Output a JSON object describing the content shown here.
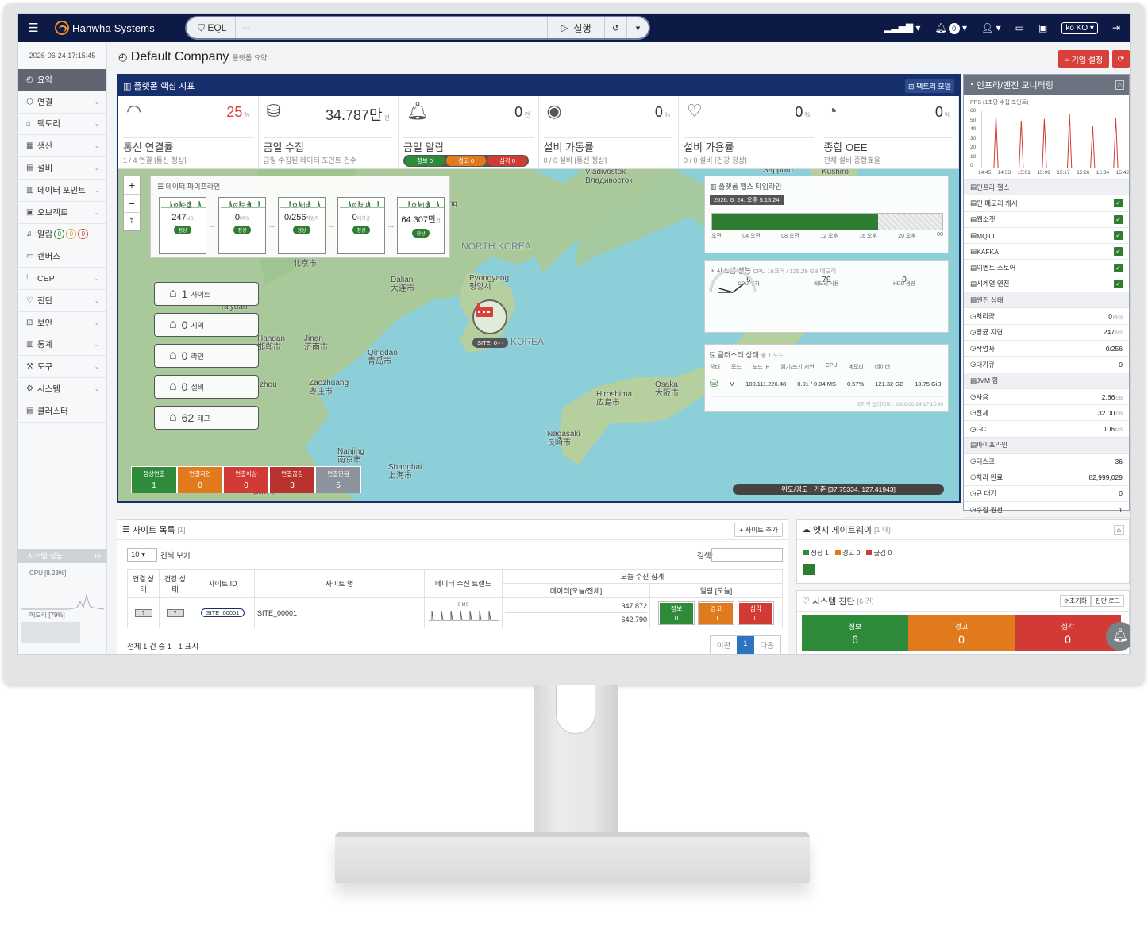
{
  "app": {
    "brand": "Hanwha Systems",
    "eql_label": "EQL",
    "run_label": "실행",
    "lang": "ko KO",
    "notif_count": "0"
  },
  "sidebar": {
    "datetime": "2026-06-24 17:15:45",
    "items": [
      {
        "label": "요약",
        "icon": "◴"
      },
      {
        "label": "연결",
        "icon": "⬡"
      },
      {
        "label": "팩토리",
        "icon": "⌂"
      },
      {
        "label": "생산",
        "icon": "▦"
      },
      {
        "label": "설비",
        "icon": "▤"
      },
      {
        "label": "데이터 포인트",
        "icon": "▥"
      },
      {
        "label": "오브젝트",
        "icon": "▣"
      },
      {
        "label": "알람",
        "icon": "♫"
      },
      {
        "label": "캔버스",
        "icon": "▭"
      },
      {
        "label": "CEP",
        "icon": "⫶"
      },
      {
        "label": "진단",
        "icon": "♡"
      },
      {
        "label": "보안",
        "icon": "⊡"
      },
      {
        "label": "통계",
        "icon": "▥"
      },
      {
        "label": "도구",
        "icon": "⚒"
      },
      {
        "label": "시스템",
        "icon": "⚙"
      },
      {
        "label": "클러스터",
        "icon": "▤"
      }
    ],
    "alarm_dots": [
      "0",
      "0",
      "0"
    ],
    "perf_title": "시스템 성능",
    "cpu": "CPU [8.23%]",
    "mem": "메모리 [79%]"
  },
  "header": {
    "title": "Default Company",
    "subtitle": "플랫폼 요약",
    "corp_btn": "기업 설정"
  },
  "kpi_panel": {
    "title": "플랫폼 핵심 지표",
    "factory_model": "팩토리 모델",
    "cards": [
      {
        "value": "25",
        "unit": "%",
        "name": "통신 연결률",
        "sub": "1 / 4 연결 [통신 정상]"
      },
      {
        "value": "34.787만",
        "unit": "건",
        "name": "금일 수집",
        "sub": "금일 수집된 데이터 포인트 건수"
      },
      {
        "value": "0",
        "unit": "건",
        "name": "금일 알람",
        "sub": ""
      },
      {
        "value": "0",
        "unit": "%",
        "name": "설비 가동률",
        "sub": "0 / 0 설비 [통신 정상]"
      },
      {
        "value": "0",
        "unit": "%",
        "name": "설비 가용률",
        "sub": "0 / 0 설비 [건강 정상]"
      },
      {
        "value": "0",
        "unit": "%",
        "name": "종합 OEE",
        "sub": "전체 설비 종합효율"
      }
    ],
    "alarm_pills": [
      {
        "label": "정보 0",
        "color": "#2e8b3a"
      },
      {
        "label": "경고 0",
        "color": "#e07a1c"
      },
      {
        "label": "심각 0",
        "color": "#d23b35"
      }
    ]
  },
  "pipeline": {
    "title": "데이터 파이프라인",
    "stages": [
      {
        "name": "수집",
        "value": "247",
        "unit": "MS",
        "ok": "정상"
      },
      {
        "name": "수신",
        "value": "0",
        "unit": "PPS",
        "ok": "정상"
      },
      {
        "name": "처리",
        "value": "0/256",
        "unit": "작업자",
        "ok": "정상"
      },
      {
        "name": "버퍼",
        "value": "0",
        "unit": "대기규",
        "ok": "정상"
      },
      {
        "name": "저장",
        "value": "64.307만",
        "unit": "건",
        "ok": "정상"
      }
    ]
  },
  "map": {
    "labels": {
      "vladivostok": "Vladivostok\nВладивосток",
      "sapporo": "Sapporo",
      "kushiro": "Kushiro",
      "north_korea": "NORTH KOREA",
      "beijing": "北京市",
      "dalian": "Dalian\n大连市",
      "pyongyang": "Pyongyang\n평양시",
      "korea": "KOREA",
      "taiyuan": "Taiyuan",
      "handan": "Handan\n邯郸市",
      "jinan": "Jinan\n济南市",
      "qingdao": "Qingdao\n青岛市",
      "zhou": "zhou",
      "zaozhuang": "Zaozhuang\n枣庄市",
      "hiroshima": "Hiroshima\n広島市",
      "osaka": "Osaka\n大阪市",
      "nagasaki": "Nagasaki\n長崎市",
      "nanjing": "Nanjing\n南京市",
      "shanghai": "Shanghai\n上海市",
      "wuhan": "Wuhan\n武汉市",
      "ng": "ng"
    },
    "badges": [
      {
        "value": "1",
        "label": "사이트"
      },
      {
        "value": "0",
        "label": "지역"
      },
      {
        "value": "0",
        "label": "라인"
      },
      {
        "value": "0",
        "label": "설비"
      },
      {
        "value": "62",
        "label": "태그"
      }
    ],
    "site_chip": "SITE_0···",
    "legend": [
      {
        "label": "정상연결",
        "value": "1",
        "color": "#2e8b3a"
      },
      {
        "label": "연결지연",
        "value": "0",
        "color": "#e07a1c"
      },
      {
        "label": "연결이상",
        "value": "0",
        "color": "#d23b35"
      },
      {
        "label": "연결끊김",
        "value": "3",
        "color": "#b8332d"
      },
      {
        "label": "연결안됨",
        "value": "5",
        "color": "#8c939c"
      }
    ],
    "coord": "위도/경도 : 기준 [37.75334, 127.41943]"
  },
  "timeline": {
    "title": "플랫폼 헬스 타임라인",
    "date": "2026. 6. 24. 오후 5:15:24",
    "ticks": [
      "오전",
      "04 오전",
      "08 오전",
      "12 오후",
      "16 오후",
      "20 오후",
      "00"
    ],
    "fill_fraction": 0.72
  },
  "sysperf": {
    "title": "시스템 성능",
    "spec": "CPU 16코어 / 125.29 GB 메모리",
    "gauges": [
      {
        "label": "CPU 부하",
        "value": "9",
        "fraction": 0.09
      },
      {
        "label": "메모리 사용",
        "value": "79",
        "fraction": 0.79
      },
      {
        "label": "HDD 용량",
        "value": "0",
        "fraction": 0
      }
    ]
  },
  "cluster": {
    "title": "클러스터 상태",
    "count": "총 1 노드",
    "cols": [
      "상태",
      "모드",
      "노드 IP",
      "읽기/쓰기 시연",
      "CPU",
      "메모리",
      "데이터"
    ],
    "row": [
      "M",
      "100.111.226.48",
      "0.01 / 0.04 MS",
      "0.57%",
      "121.32 GB",
      "18.75 GiB"
    ],
    "updated": "마지막 업데이트 : 2026-06-24 17:15:43"
  },
  "infra": {
    "title": "인프라/엔진 모니터링",
    "pps_title": "PPS (1초당 수집 포인트)",
    "pps_y": [
      "60",
      "50",
      "40",
      "30",
      "20",
      "10",
      "0"
    ],
    "pps_x": [
      "14:45",
      "14:53",
      "15:01",
      "15:09",
      "15:17",
      "15:26",
      "15:34",
      "15:42"
    ],
    "pps_series": [
      0,
      0,
      0,
      0,
      0,
      0,
      0,
      55,
      0,
      0,
      0,
      0,
      0,
      0,
      0,
      0,
      0,
      0,
      0,
      50,
      0,
      0,
      0,
      0,
      0,
      0,
      0,
      0,
      0,
      0,
      52,
      0,
      0,
      0,
      0,
      0,
      0,
      0,
      0,
      0,
      0,
      0,
      57,
      0,
      0,
      0,
      0,
      0,
      0,
      0,
      0,
      0,
      0,
      45,
      0,
      0,
      0,
      0,
      0,
      0,
      0,
      0,
      0,
      0,
      53,
      0,
      0,
      0,
      0
    ],
    "health_title": "인프라 헬스",
    "health": [
      "인 메모리 캐시",
      "웹소켓",
      "MQTT",
      "KAFKA",
      "이벤트 스토어",
      "시계열 엔진"
    ],
    "engine_title": "엔진 상태",
    "engine": [
      {
        "k": "처리량",
        "v": "0",
        "u": "PPS"
      },
      {
        "k": "평균 지연",
        "v": "247",
        "u": "MS"
      },
      {
        "k": "작업자",
        "v": "0/256",
        "u": ""
      },
      {
        "k": "대기큐",
        "v": "0",
        "u": ""
      }
    ],
    "jvm_title": "JVM 힙",
    "jvm": [
      {
        "k": "사용",
        "v": "2.66",
        "u": "GB"
      },
      {
        "k": "전체",
        "v": "32.00",
        "u": "GB"
      },
      {
        "k": "GC",
        "v": "106",
        "u": "MS"
      }
    ],
    "pipe_title": "파이프라인",
    "pipe": [
      {
        "k": "태스크",
        "v": "36"
      },
      {
        "k": "처리 완료",
        "v": "82,999,029"
      },
      {
        "k": "큐 대기",
        "v": "0"
      },
      {
        "k": "수집 원천",
        "v": "1"
      }
    ]
  },
  "sites": {
    "title": "사이트 목록",
    "count": "[1]",
    "add": "+ 사이트 추가",
    "page_size": "10",
    "per_page_label": "건씩 보기",
    "search_label": "검색:",
    "cols": [
      "연결 상태",
      "건강 상태",
      "사이트 ID",
      "사이트 명",
      "데이터 수신 트렌드",
      "데이터[오늘/전체]",
      "알람 [오늘]"
    ],
    "group": "오늘 수신 집계",
    "row": {
      "id": "SITE_00001",
      "name": "SITE_00001",
      "trend": "0 MS",
      "today": "347,872",
      "total": "642,790",
      "alarms": [
        {
          "label": "정보",
          "v": "0",
          "color": "#2e8b3a"
        },
        {
          "label": "경고",
          "v": "0",
          "color": "#e07a1c"
        },
        {
          "label": "심각",
          "v": "0",
          "color": "#d23b35"
        }
      ]
    },
    "footer": "전체 1 건 중 1 - 1 표시",
    "prev": "이전",
    "page": "1",
    "next": "다음"
  },
  "edge": {
    "title": "엣지 게이트웨이",
    "count": "[1 대]",
    "legend": [
      {
        "label": "정상 1",
        "color": "#2e8b3a"
      },
      {
        "label": "경고 0",
        "color": "#e07a1c"
      },
      {
        "label": "끊김 0",
        "color": "#d23b35"
      }
    ]
  },
  "diag": {
    "title": "시스템 진단",
    "count": "[6 건]",
    "reset": "초기화",
    "go": "진단 로그",
    "cells": [
      {
        "label": "정보",
        "v": "6",
        "color": "#2e8b3a"
      },
      {
        "label": "경고",
        "v": "0",
        "color": "#e07a1c"
      },
      {
        "label": "심각",
        "v": "0",
        "color": "#d23b35"
      }
    ]
  }
}
